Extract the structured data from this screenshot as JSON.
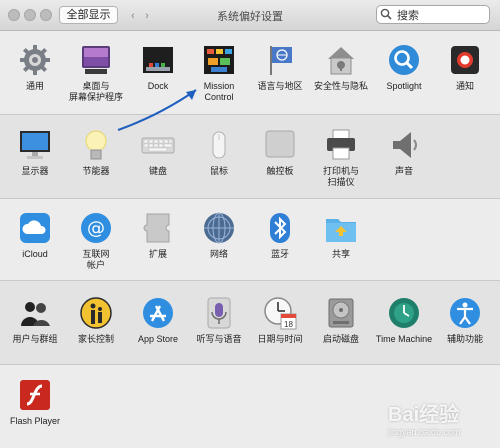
{
  "window": {
    "title": "系统偏好设置",
    "show_all_label": "全部显示",
    "search_value": "搜索",
    "back_glyph": "‹",
    "forward_glyph": "›"
  },
  "sections": [
    {
      "items": [
        {
          "label": "通用",
          "icon": "general-icon"
        },
        {
          "label": "桌面与\n屏幕保护程序",
          "icon": "desktop-screensaver-icon"
        },
        {
          "label": "Dock",
          "icon": "dock-icon"
        },
        {
          "label": "Mission\nControl",
          "icon": "mission-control-icon"
        },
        {
          "label": "语言与地区",
          "icon": "language-region-icon"
        },
        {
          "label": "安全性与隐私",
          "icon": "security-privacy-icon"
        },
        {
          "label": "Spotlight",
          "icon": "spotlight-icon"
        },
        {
          "label": "通知",
          "icon": "notifications-icon"
        }
      ]
    },
    {
      "items": [
        {
          "label": "显示器",
          "icon": "displays-icon"
        },
        {
          "label": "节能器",
          "icon": "energy-saver-icon"
        },
        {
          "label": "键盘",
          "icon": "keyboard-icon"
        },
        {
          "label": "鼠标",
          "icon": "mouse-icon"
        },
        {
          "label": "触控板",
          "icon": "trackpad-icon"
        },
        {
          "label": "打印机与\n扫描仪",
          "icon": "printers-scanners-icon"
        },
        {
          "label": "声音",
          "icon": "sound-icon"
        }
      ]
    },
    {
      "items": [
        {
          "label": "iCloud",
          "icon": "icloud-icon"
        },
        {
          "label": "互联网\n帐户",
          "icon": "internet-accounts-icon"
        },
        {
          "label": "扩展",
          "icon": "extensions-icon"
        },
        {
          "label": "网络",
          "icon": "network-icon"
        },
        {
          "label": "蓝牙",
          "icon": "bluetooth-icon"
        },
        {
          "label": "共享",
          "icon": "sharing-icon"
        }
      ]
    },
    {
      "items": [
        {
          "label": "用户与群组",
          "icon": "users-groups-icon"
        },
        {
          "label": "家长控制",
          "icon": "parental-controls-icon"
        },
        {
          "label": "App Store",
          "icon": "app-store-icon"
        },
        {
          "label": "听写与语音",
          "icon": "dictation-speech-icon"
        },
        {
          "label": "日期与时间",
          "icon": "date-time-icon"
        },
        {
          "label": "启动磁盘",
          "icon": "startup-disk-icon"
        },
        {
          "label": "Time Machine",
          "icon": "time-machine-icon"
        },
        {
          "label": "辅助功能",
          "icon": "accessibility-icon"
        }
      ]
    },
    {
      "items": [
        {
          "label": "Flash Player",
          "icon": "flash-player-icon"
        }
      ]
    }
  ],
  "calendar_badge": "18",
  "watermark_text": "Bai经验",
  "watermark_url": "jingyan.baidu.com"
}
